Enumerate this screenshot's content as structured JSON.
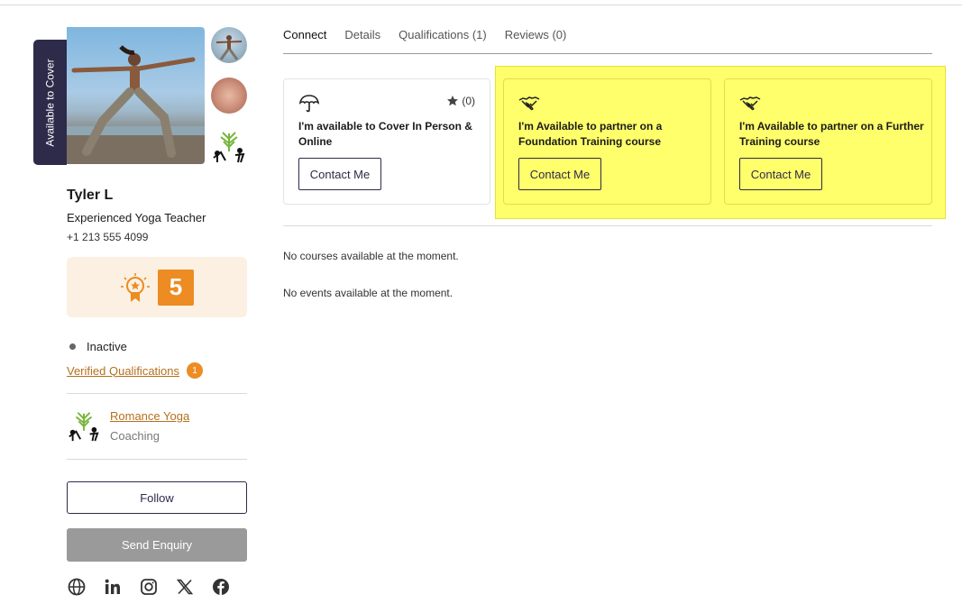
{
  "profile": {
    "cover_tab_label": "Available to Cover",
    "name": "Tyler L",
    "headline": "Experienced Yoga Teacher",
    "phone": "+1 213 555 4099",
    "score": "5",
    "status": "Inactive",
    "verified_label": "Verified Qualifications",
    "verified_count": "1",
    "organisation": {
      "name": "Romance Yoga",
      "type": "Coaching"
    },
    "follow_label": "Follow",
    "enquiry_label": "Send Enquiry",
    "socials": [
      "globe-icon",
      "linkedin-icon",
      "instagram-icon",
      "x-icon",
      "facebook-icon"
    ]
  },
  "tabs": [
    {
      "label": "Connect",
      "active": true
    },
    {
      "label": "Details",
      "active": false
    },
    {
      "label": "Qualifications (1)",
      "active": false
    },
    {
      "label": "Reviews (0)",
      "active": false
    }
  ],
  "cards": [
    {
      "icon": "umbrella-icon",
      "rating": "(0)",
      "title": "I'm available to Cover In Person & Online",
      "button": "Contact Me"
    },
    {
      "icon": "handshake-icon",
      "title": "I'm Available to partner on a Foundation Training course",
      "button": "Contact Me"
    },
    {
      "icon": "handshake-icon",
      "title": "I'm Available to partner on a Further Training course",
      "button": "Contact Me"
    }
  ],
  "messages": {
    "courses": "No courses available at the moment.",
    "events": "No events available at the moment."
  },
  "colors": {
    "accent": "#ec8c23",
    "link": "#b4701c",
    "dark": "#2e2a4a",
    "highlight": "#ffff6b"
  }
}
